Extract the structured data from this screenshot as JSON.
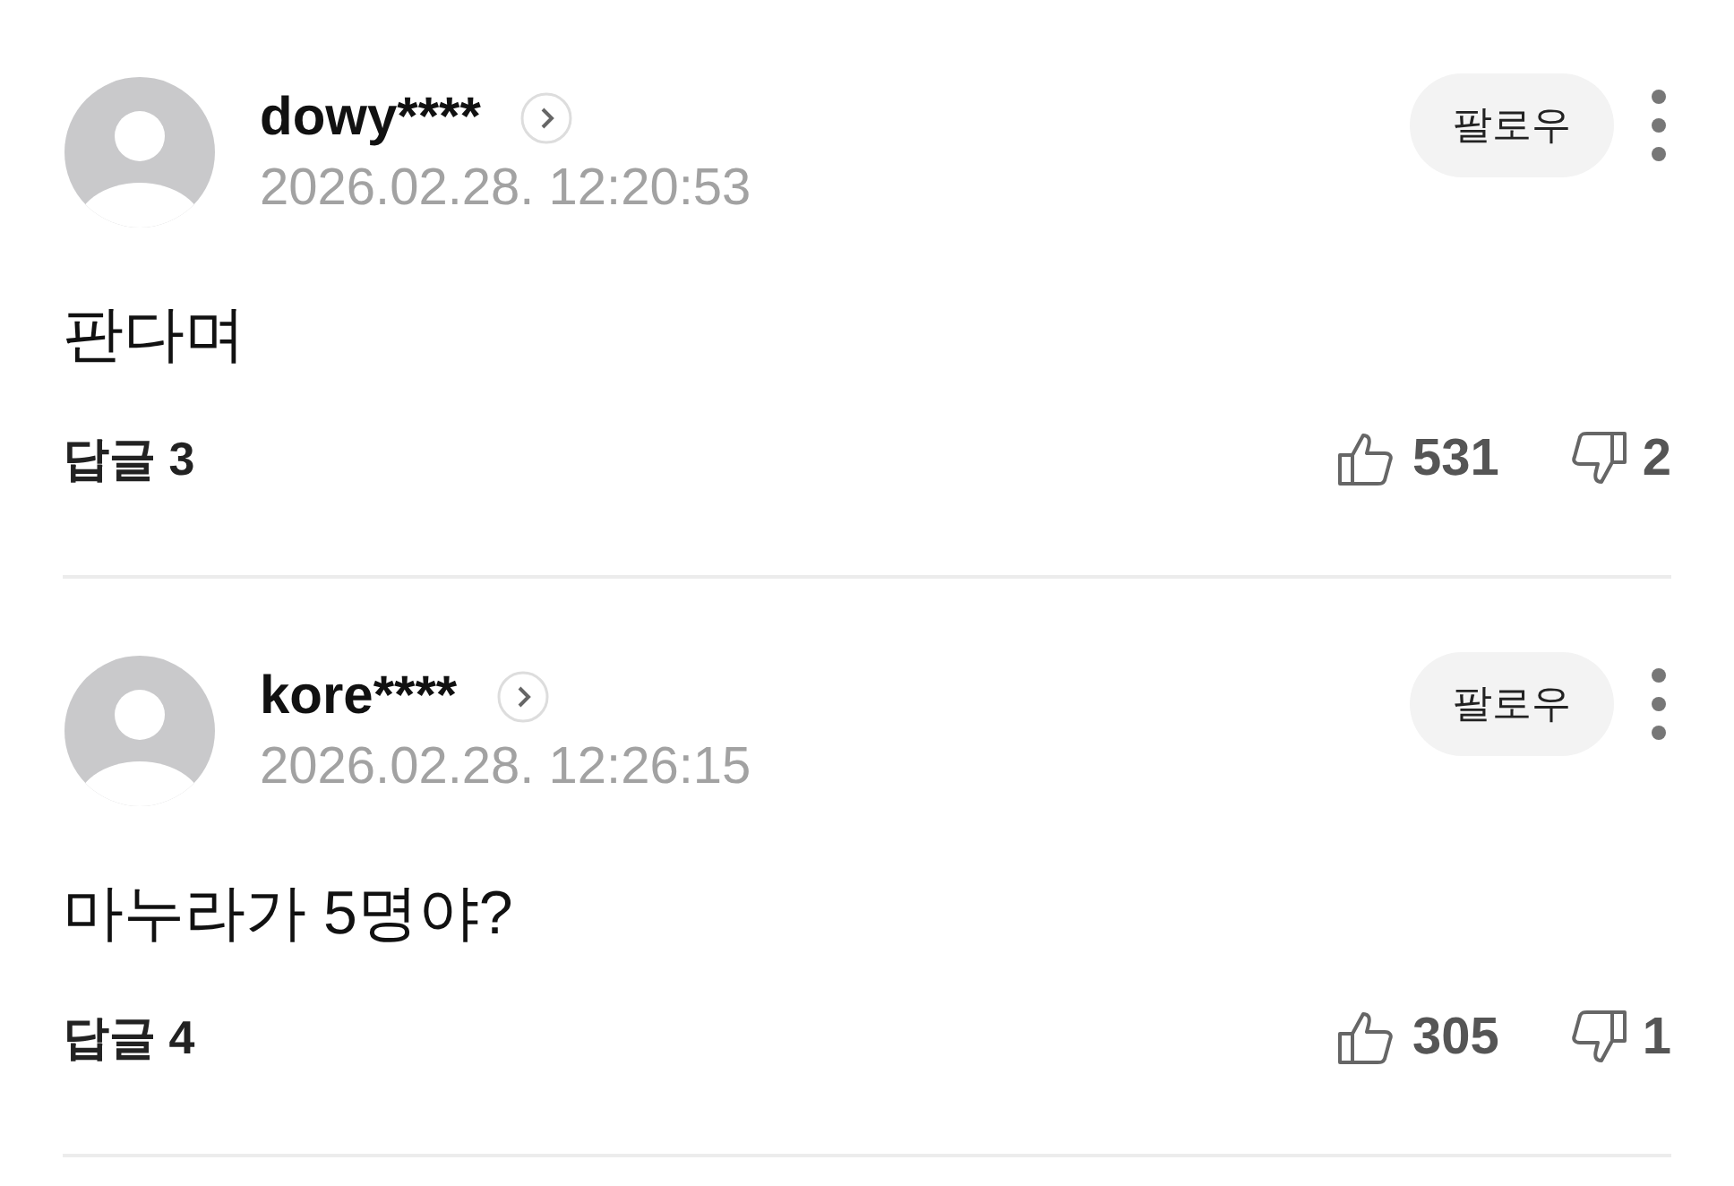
{
  "comments": [
    {
      "username": "dowy****",
      "date": "2026.02.28. 12:20:53",
      "follow": "팔로우",
      "text": "판다며",
      "replies": "답글 3",
      "likes": "531",
      "dislikes": "2"
    },
    {
      "username": "kore****",
      "date": "2026.02.28. 12:26:15",
      "follow": "팔로우",
      "text": "마누라가 5명야?",
      "replies": "답글 4",
      "likes": "305",
      "dislikes": "1"
    }
  ]
}
